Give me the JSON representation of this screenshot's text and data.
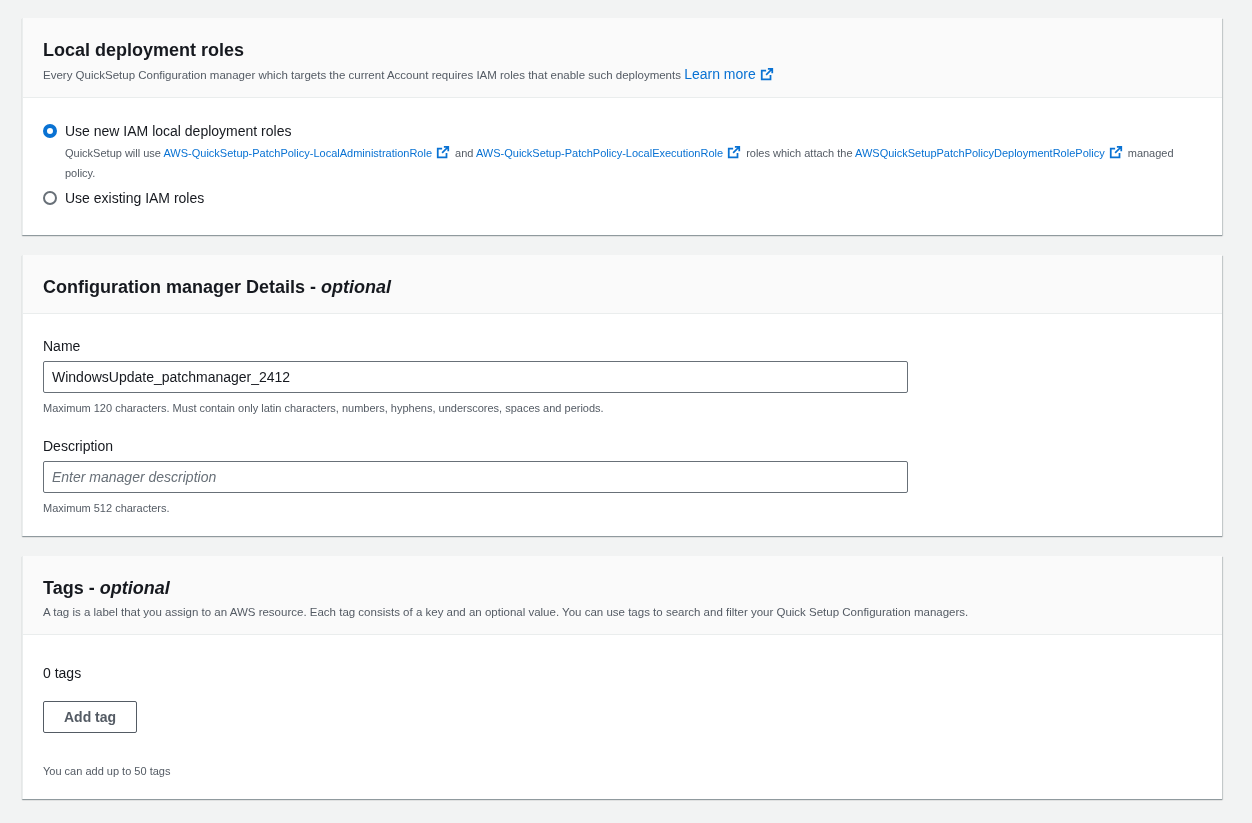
{
  "roles_panel": {
    "title": "Local deployment roles",
    "description": [
      {
        "kind": "text",
        "text": "Every QuickSetup Configuration manager which targets the current Account requires IAM roles that enable such deployments "
      },
      {
        "kind": "biglink",
        "text": "Learn more"
      }
    ],
    "options": [
      {
        "label": "Use new IAM local deployment roles",
        "selected": true,
        "description": [
          {
            "kind": "text",
            "text": "QuickSetup will use "
          },
          {
            "kind": "link",
            "text": "AWS-QuickSetup-PatchPolicy-LocalAdministrationRole"
          },
          {
            "kind": "text",
            "text": " and "
          },
          {
            "kind": "link",
            "text": "AWS-QuickSetup-PatchPolicy-LocalExecutionRole"
          },
          {
            "kind": "text",
            "text": " roles which attach the "
          },
          {
            "kind": "link",
            "text": "AWSQuickSetupPatchPolicyDeploymentRolePolicy"
          },
          {
            "kind": "text",
            "text": " managed policy."
          }
        ]
      },
      {
        "label": "Use existing IAM roles",
        "selected": false
      }
    ]
  },
  "details_panel": {
    "title": "Configuration manager Details - *optional*",
    "fields": [
      {
        "label": "Name",
        "value": "WindowsUpdate_patchmanager_2412",
        "constraint": "Maximum 120 characters. Must contain only latin characters, numbers, hyphens, underscores, spaces and periods."
      },
      {
        "label": "Description",
        "placeholder": "Enter manager description",
        "constraint": "Maximum 512 characters."
      }
    ]
  },
  "tags_panel": {
    "title": "Tags - *optional*",
    "description": "A tag is a label that you assign to an AWS resource. Each tag consists of a key and an optional value. You can use tags to search and filter your Quick Setup Configuration managers.",
    "count": "0 tags",
    "button": "Add tag",
    "hint": "You can add up to 50 tags"
  }
}
